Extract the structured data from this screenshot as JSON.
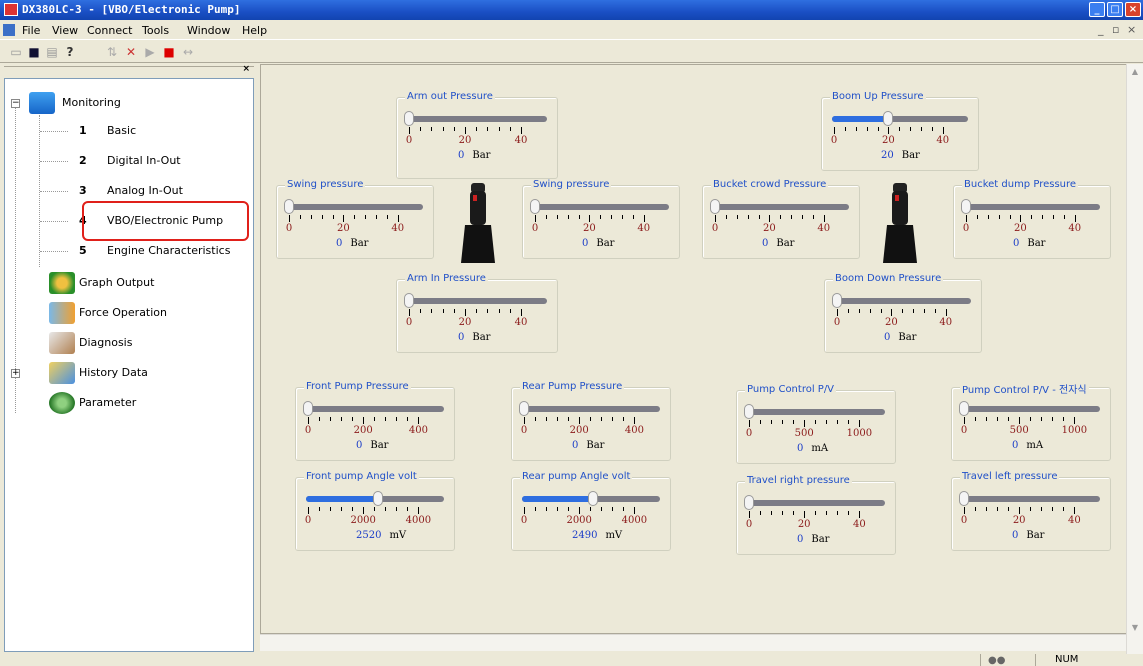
{
  "window": {
    "title": "DX380LC-3 - [VBO/Electronic Pump]"
  },
  "menu": [
    "File",
    "View",
    "Connect",
    "Tools",
    "Window",
    "Help"
  ],
  "tree": {
    "monitoring": "Monitoring",
    "sub": [
      {
        "num": "1",
        "label": "Basic"
      },
      {
        "num": "2",
        "label": "Digital In-Out"
      },
      {
        "num": "3",
        "label": "Analog In-Out"
      },
      {
        "num": "4",
        "label": "VBO/Electronic Pump"
      },
      {
        "num": "5",
        "label": "Engine Characteristics"
      }
    ],
    "others": [
      "Graph Output",
      "Force Operation",
      "Diagnosis",
      "History Data",
      "Parameter"
    ]
  },
  "gauges": [
    {
      "title": "Arm out Pressure",
      "ticks": [
        "0",
        "20",
        "40"
      ],
      "value": "0",
      "unit": "Bar",
      "level": 0
    },
    {
      "title": "Boom Up Pressure",
      "ticks": [
        "0",
        "20",
        "40"
      ],
      "value": "20",
      "unit": "Bar",
      "level": 0.4
    },
    {
      "title": "Swing pressure",
      "ticks": [
        "0",
        "20",
        "40"
      ],
      "value": "0",
      "unit": "Bar",
      "level": 0
    },
    {
      "title": "Swing pressure",
      "ticks": [
        "0",
        "20",
        "40"
      ],
      "value": "0",
      "unit": "Bar",
      "level": 0
    },
    {
      "title": "Bucket crowd Pressure",
      "ticks": [
        "0",
        "20",
        "40"
      ],
      "value": "0",
      "unit": "Bar",
      "level": 0
    },
    {
      "title": "Bucket dump Pressure",
      "ticks": [
        "0",
        "20",
        "40"
      ],
      "value": "0",
      "unit": "Bar",
      "level": 0
    },
    {
      "title": "Arm In Pressure",
      "ticks": [
        "0",
        "20",
        "40"
      ],
      "value": "0",
      "unit": "Bar",
      "level": 0
    },
    {
      "title": "Boom Down Pressure",
      "ticks": [
        "0",
        "20",
        "40"
      ],
      "value": "0",
      "unit": "Bar",
      "level": 0
    },
    {
      "title": "Front Pump Pressure",
      "ticks": [
        "0",
        "200",
        "400"
      ],
      "value": "0",
      "unit": "Bar",
      "level": 0
    },
    {
      "title": "Rear Pump Pressure",
      "ticks": [
        "0",
        "200",
        "400"
      ],
      "value": "0",
      "unit": "Bar",
      "level": 0
    },
    {
      "title": "Pump Control P/V",
      "ticks": [
        "0",
        "500",
        "1000"
      ],
      "value": "0",
      "unit": "mA",
      "level": 0
    },
    {
      "title": "Pump Control P/V - 전자식",
      "ticks": [
        "0",
        "500",
        "1000"
      ],
      "value": "0",
      "unit": "mA",
      "level": 0
    },
    {
      "title": "Front pump Angle volt",
      "ticks": [
        "0",
        "2000",
        "4000"
      ],
      "value": "2520",
      "unit": "mV",
      "level": 0.504
    },
    {
      "title": "Rear pump Angle volt",
      "ticks": [
        "0",
        "2000",
        "4000"
      ],
      "value": "2490",
      "unit": "mV",
      "level": 0.498
    },
    {
      "title": "Travel right pressure",
      "ticks": [
        "0",
        "20",
        "40"
      ],
      "value": "0",
      "unit": "Bar",
      "level": 0
    },
    {
      "title": "Travel left pressure",
      "ticks": [
        "0",
        "20",
        "40"
      ],
      "value": "0",
      "unit": "Bar",
      "level": 0
    }
  ],
  "status": {
    "num": "NUM"
  }
}
